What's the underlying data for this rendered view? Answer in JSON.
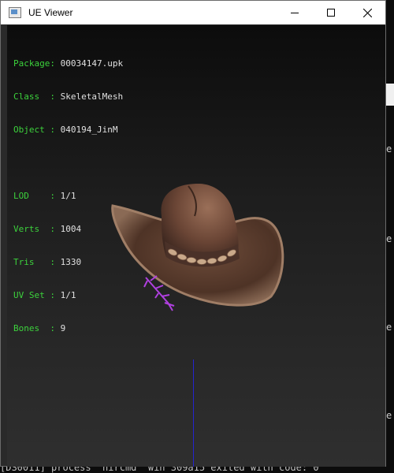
{
  "window": {
    "title": "UE Viewer"
  },
  "info": {
    "package_label": "Package:",
    "package_value": "00034147.upk",
    "class_label": "Class  :",
    "class_value": "SkeletalMesh",
    "object_label": "Object :",
    "object_value": "040194_JinM",
    "lod_label": "LOD    :",
    "lod_value": "1/1",
    "verts_label": "Verts  :",
    "verts_value": "1004",
    "tris_label": "Tris   :",
    "tris_value": "1330",
    "uvset_label": "UV Set :",
    "uvset_value": "1/1",
    "bones_label": "Bones  :",
    "bones_value": "9"
  },
  "console": {
    "bottom_line": "[DS0011] process 'nircmd' win 309a15 exited with code: 0"
  },
  "colors": {
    "label": "#3cd23c",
    "value": "#e0e0e0",
    "axis": "#2424d0",
    "bones": "#b040e0"
  },
  "icons": [
    "app-icon",
    "minimize-icon",
    "maximize-icon",
    "close-icon"
  ]
}
